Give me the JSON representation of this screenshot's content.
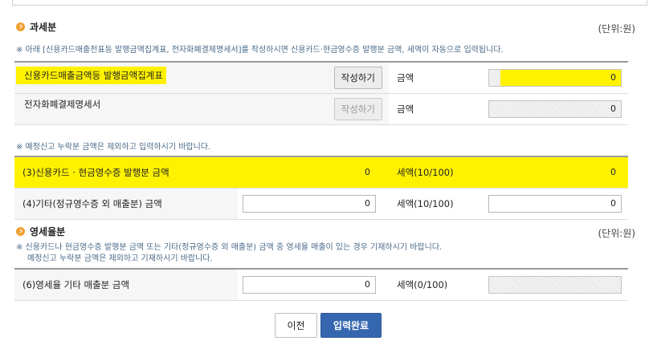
{
  "sections": {
    "taxable": {
      "title": "과세분",
      "unit": "(단위:원)",
      "note": "※ 아래 [신용카드매출전표등 발행금액집계표, 전자화폐결제명세서]를 작성하시면 신용카드·현금영수증 발행분 금액, 세액이 자동으로 입력됩니다.",
      "rows": [
        {
          "label": "신용카드매출금액등 발행금액집계표",
          "button": "작성하기",
          "amount_label": "금액",
          "amount": "0"
        },
        {
          "label": "전자화폐결제명세서",
          "button": "작성하기",
          "amount_label": "금액",
          "amount": "0"
        }
      ],
      "note2": "※ 예정신고 누락분 금액은 제외하고 입력하시기 바랍니다.",
      "rows2": [
        {
          "label": "(3)신용카드 · 현금영수증 발행분 금액",
          "amount": "0",
          "tax_label": "세액(10/100)",
          "tax": "0"
        },
        {
          "label": "(4)기타(정규영수증 외 매출분) 금액",
          "amount": "0",
          "tax_label": "세액(10/100)",
          "tax": "0"
        }
      ]
    },
    "zero_rated": {
      "title": "영세율분",
      "unit": "(단위:원)",
      "note_line1": "※ 신용카드나 현금영수증 발행분 금액 또는 기타(정규영수증 외 매출분) 금액 중 영세율 매출이 있는 경우 기재하시기 바랍니다.",
      "note_line2": "예정신고 누락분 금액은 제외하고 기재하시기 바랍니다.",
      "row": {
        "label": "(6)영세율 기타 매출분 금액",
        "amount": "0",
        "tax_label": "세액(0/100)",
        "tax": ""
      }
    }
  },
  "buttons": {
    "prev": "이전",
    "done": "입력완료"
  },
  "colors": {
    "highlight": "#fff200",
    "primary": "#3567b0",
    "note": "#4a6b8a"
  }
}
